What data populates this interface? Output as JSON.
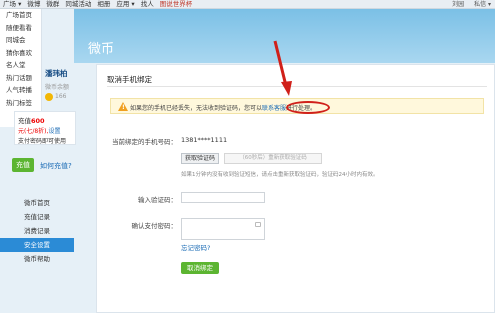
{
  "topnav": {
    "items": [
      "广场 ▾",
      "微博",
      "微群",
      "同城活动",
      "相册",
      "应用 ▾",
      "找人"
    ],
    "highlight": "图说世界杯",
    "right": [
      "刘园",
      "私信 ▾"
    ]
  },
  "leftnav": {
    "items": [
      "广场首页",
      "随便看看",
      "同城会",
      "猜你喜欢",
      "名人堂",
      "热门话题",
      "人气转播",
      "热门标签"
    ]
  },
  "banner": {
    "title": "微币"
  },
  "profile": {
    "name": "潘玮柏",
    "balance_label": "微币余额",
    "coin_amount": "166"
  },
  "promo": {
    "line1_prefix": "充值",
    "line1_amount": "600",
    "line2_prefix": "元(七/8折),",
    "line2_link": "设置",
    "line3": "支付密码即可使用"
  },
  "recharge": {
    "button_label": "充值",
    "how_link": "如何充值?"
  },
  "menu": {
    "items": [
      "微币首页",
      "充值记录",
      "消费记录",
      "安全设置",
      "微币帮助"
    ],
    "active_index": 3
  },
  "main": {
    "heading": "取消手机绑定",
    "warning": {
      "text_before": "如果您的手机已经丢失，无法收到验证码，您可以",
      "link": "联系客服",
      "text_after": "进行处理。"
    },
    "form": {
      "phone_label": "当前绑定的手机号码：",
      "phone_value": "1381****1111",
      "get_code_button": "获取验证码",
      "resend_button": "（60秒后）重新获取验证码",
      "hint": "如果1分钟内没有收到验证短信，请点击重新获取验证码，验证码24小时内有效。",
      "code_label": "输入验证码：",
      "pwd_label": "确认支付密码：",
      "forgot_link": "忘记密码?",
      "unbind_button": "取消绑定"
    }
  },
  "colors": {
    "accent_blue": "#2b8bd6",
    "green": "#5cb531",
    "red_annotation": "#d0201a",
    "banner_blue": "#7bc0e6"
  }
}
